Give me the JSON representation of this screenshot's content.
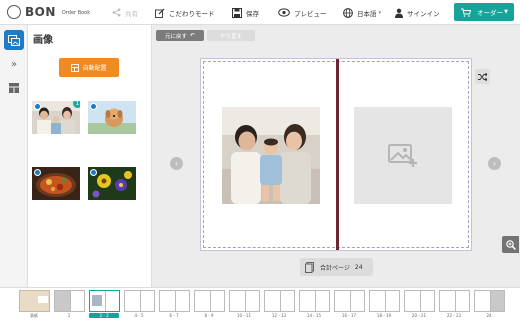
{
  "header": {
    "logo_main": "BON",
    "logo_sub": "Order Book",
    "share_label": "共有",
    "mode_label": "こだわりモード",
    "save_label": "保存",
    "preview_label": "プレビュー",
    "lang_label": "日本語",
    "signin_label": "サインイン",
    "order_label": "オーダー"
  },
  "panel": {
    "title": "画像",
    "autoplace_label": "自動配置",
    "thumbs": [
      {
        "name": "family-photo",
        "count": "1"
      },
      {
        "name": "dog-photo"
      },
      {
        "name": "food-photo"
      },
      {
        "name": "flowers-photo"
      }
    ]
  },
  "canvas": {
    "undo_label": "元に戻す",
    "redo_label": "やり直す",
    "pagecount_label": "合計ページ",
    "pagecount_value": "24"
  },
  "filmstrip": {
    "labels": [
      "表紙",
      "1",
      "2 - 3",
      "4 - 5",
      "6 - 7",
      "8 - 9",
      "10 - 11",
      "12 - 13",
      "14 - 15",
      "16 - 17",
      "18 - 19",
      "20 - 21",
      "22 - 23",
      "24"
    ]
  },
  "colors": {
    "accent": "#17a39a",
    "primary": "#1e7bc6",
    "orange": "#f08a22"
  }
}
